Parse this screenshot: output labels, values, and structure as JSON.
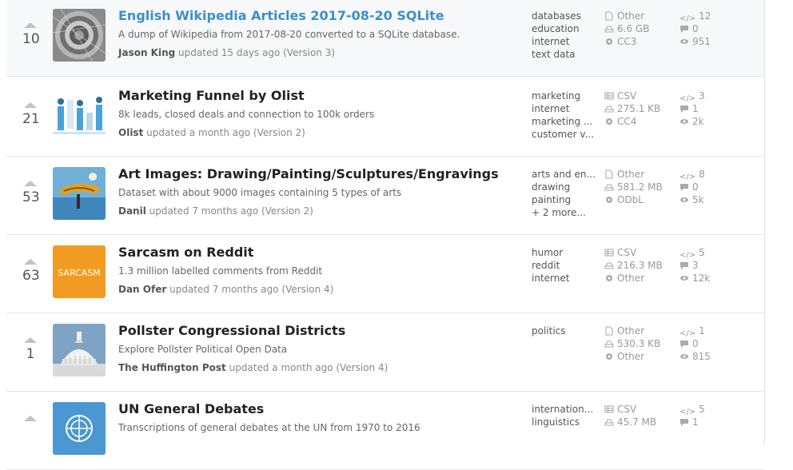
{
  "datasets": [
    {
      "votes": "10",
      "title": "English Wikipedia Articles 2017-08-20 SQLite",
      "description": "A dump of Wikipedia from 2017-08-20 converted to a SQLite database.",
      "author": "Jason King",
      "updated": "updated 15 days ago (Version 3)",
      "tags": [
        "databases",
        "education",
        "internet",
        "text data"
      ],
      "file_type": "Other",
      "size": "6.6 GB",
      "license": "CC3",
      "kernels": "12",
      "comments": "0",
      "views": "951"
    },
    {
      "votes": "21",
      "title": "Marketing Funnel by Olist",
      "description": "8k leads, closed deals and connection to 100k orders",
      "author": "Olist",
      "updated": "updated a month ago (Version 2)",
      "tags": [
        "marketing",
        "internet",
        "marketing ...",
        "customer v..."
      ],
      "file_type": "CSV",
      "size": "275.1 KB",
      "license": "CC4",
      "kernels": "3",
      "comments": "1",
      "views": "2k"
    },
    {
      "votes": "53",
      "title": "Art Images: Drawing/Painting/Sculptures/Engravings",
      "description": "Dataset with about 9000 images containing 5 types of arts",
      "author": "Danil",
      "updated": "updated 7 months ago (Version 2)",
      "tags": [
        "arts and en...",
        "drawing",
        "painting",
        "+ 2 more..."
      ],
      "file_type": "Other",
      "size": "581.2 MB",
      "license": "ODbL",
      "kernels": "8",
      "comments": "0",
      "views": "5k"
    },
    {
      "votes": "63",
      "title": "Sarcasm on Reddit",
      "description": "1.3 million labelled comments from Reddit",
      "author": "Dan Ofer",
      "updated": "updated 7 months ago (Version 4)",
      "tags": [
        "humor",
        "reddit",
        "internet"
      ],
      "file_type": "CSV",
      "size": "216.3 MB",
      "license": "Other",
      "kernels": "5",
      "comments": "3",
      "views": "12k",
      "thumb_text": "SARCASM"
    },
    {
      "votes": "1",
      "title": "Pollster Congressional Districts",
      "description": "Explore Pollster Political Open Data",
      "author": "The Huffington Post",
      "updated": "updated a month ago (Version 4)",
      "tags": [
        "politics"
      ],
      "file_type": "Other",
      "size": "530.3 KB",
      "license": "Other",
      "kernels": "1",
      "comments": "0",
      "views": "815"
    },
    {
      "votes": "",
      "title": "UN General Debates",
      "description": "Transcriptions of general debates at the UN from 1970 to 2016",
      "author": "",
      "updated": "",
      "tags": [
        "internation...",
        "linguistics"
      ],
      "file_type": "CSV",
      "size": "45.7 MB",
      "license": "",
      "kernels": "5",
      "comments": "1",
      "views": ""
    }
  ],
  "colors": {
    "title_link": "#3e8fc7",
    "highlight_row": "#f7f8f9",
    "sarcasm_orange": "#f29b22",
    "un_blue": "#4a97d1"
  },
  "icons": {
    "file_type": "file-icon",
    "size": "disk-icon",
    "license": "gear-icon",
    "kernels": "code-icon",
    "comments": "comment-icon",
    "views": "eye-icon"
  }
}
